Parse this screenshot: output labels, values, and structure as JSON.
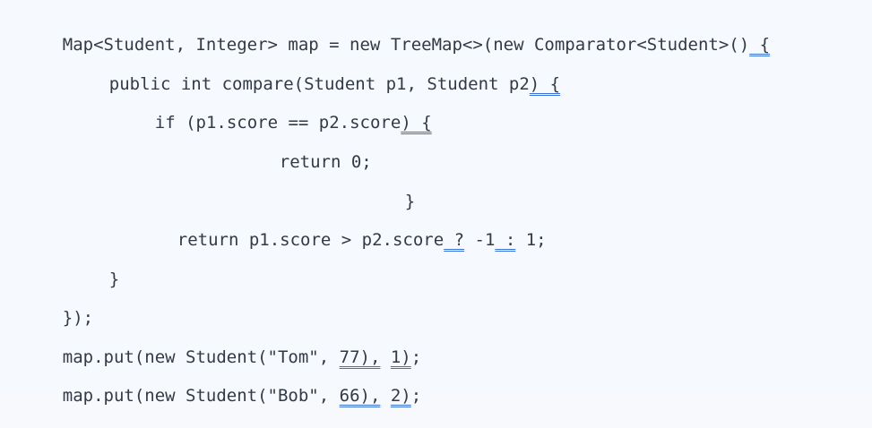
{
  "lines": [
    {
      "text": "Map<Student, Integer> map = new TreeMap<>(new Comparator<Student>()",
      "mark": " {"
    },
    {
      "text": "public int compare(Student p1, Student p2",
      "mark": ") {"
    },
    {
      "text": "if (p1.score == p2.score",
      "mark": ") {"
    },
    {
      "text": "return 0;",
      "mark": ""
    },
    {
      "text": "}",
      "mark": ""
    },
    {
      "text": "return p1.score > p2.score",
      "mark": " ?",
      "mid": " -1",
      "mark2": " :",
      "tail": " 1;"
    },
    {
      "text": "}",
      "mark": ""
    },
    {
      "text": "});",
      "mark": ""
    },
    {
      "text": "map.put(new Student(\"Tom\", ",
      "mark": "77),",
      "mid": " ",
      "mark2": "1)",
      "tail": ";"
    },
    {
      "text": "map.put(new Student(\"Bob\", ",
      "mark": "66),",
      "mid": " ",
      "mark2": "2)",
      "tail": ";"
    }
  ]
}
